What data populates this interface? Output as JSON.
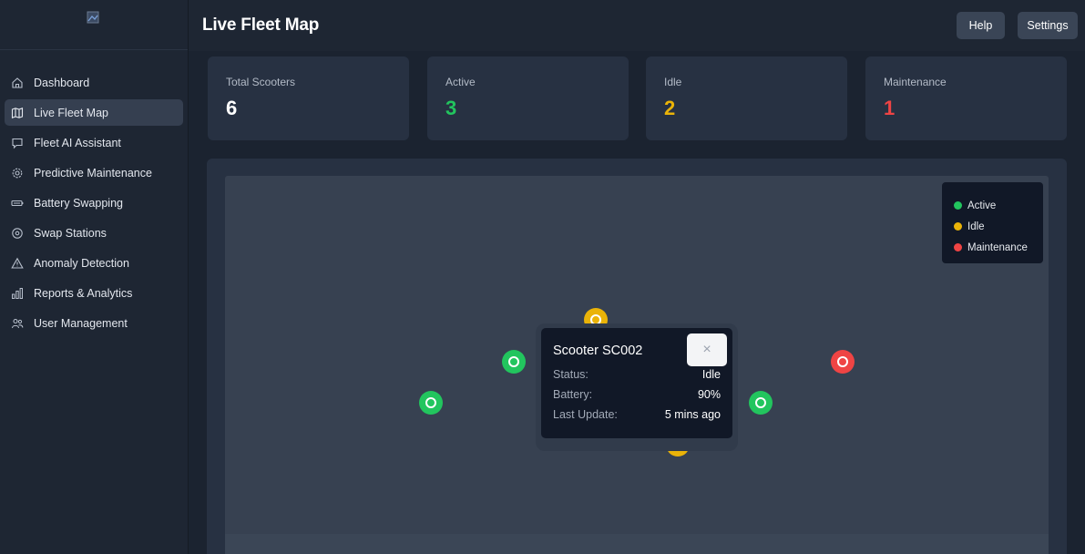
{
  "sidebar": {
    "logo_alt": "",
    "items": [
      {
        "label": "Dashboard",
        "icon": "home-icon"
      },
      {
        "label": "Live Fleet Map",
        "icon": "map-icon",
        "active": true
      },
      {
        "label": "Fleet AI Assistant",
        "icon": "chat-icon"
      },
      {
        "label": "Predictive Maintenance",
        "icon": "gear-icon"
      },
      {
        "label": "Battery Swapping",
        "icon": "battery-icon"
      },
      {
        "label": "Swap Stations",
        "icon": "location-pin-icon"
      },
      {
        "label": "Anomaly Detection",
        "icon": "warning-icon"
      },
      {
        "label": "Reports & Analytics",
        "icon": "bar-chart-icon"
      },
      {
        "label": "User Management",
        "icon": "users-icon"
      }
    ]
  },
  "header": {
    "title": "Live Fleet Map",
    "help_label": "Help",
    "settings_label": "Settings"
  },
  "stats": [
    {
      "label": "Total Scooters",
      "value": "6",
      "color": "#ffffff"
    },
    {
      "label": "Active",
      "value": "3",
      "color": "#22c55e"
    },
    {
      "label": "Idle",
      "value": "2",
      "color": "#eab308"
    },
    {
      "label": "Maintenance",
      "value": "1",
      "color": "#ef4444"
    }
  ],
  "legend": [
    {
      "label": "Active",
      "color": "#22c55e"
    },
    {
      "label": "Idle",
      "color": "#eab308"
    },
    {
      "label": "Maintenance",
      "color": "#ef4444"
    }
  ],
  "markers": [
    {
      "status": "Idle"
    },
    {
      "status": "Active"
    },
    {
      "status": "Maintenance"
    },
    {
      "status": "Active"
    },
    {
      "status": "Active"
    },
    {
      "status": "Idle"
    }
  ],
  "popup": {
    "title": "Scooter SC002",
    "close_symbol": "×",
    "rows": [
      {
        "key": "Status:",
        "value": "Idle"
      },
      {
        "key": "Battery:",
        "value": "90%"
      },
      {
        "key": "Last Update:",
        "value": "5 mins ago"
      }
    ]
  }
}
